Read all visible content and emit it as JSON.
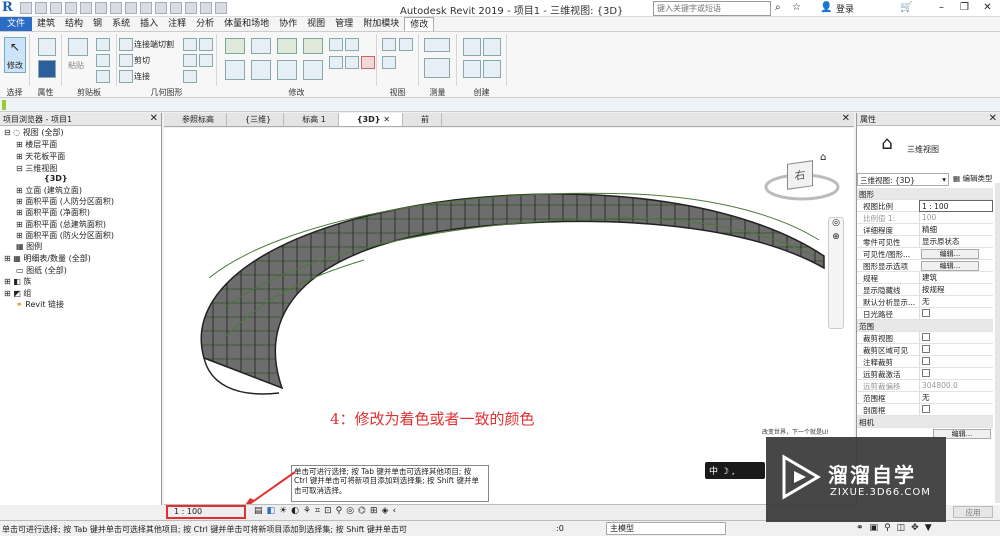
{
  "titlebar": {
    "title": "Autodesk Revit 2019 - 项目1 - 三维视图: {3D}",
    "search_placeholder": "键入关键字或短语",
    "login": "登录"
  },
  "menu": [
    "文件",
    "建筑",
    "结构",
    "钢",
    "系统",
    "插入",
    "注释",
    "分析",
    "体量和场地",
    "协作",
    "视图",
    "管理",
    "附加模块",
    "修改"
  ],
  "ribbon": {
    "modify": "修改",
    "groups": [
      "选择",
      "属性",
      "剪贴板",
      "几何图形",
      "修改",
      "视图",
      "测量",
      "创建"
    ],
    "paste": "粘贴",
    "join_cut": "连接端切割",
    "cut": "剪切",
    "join": "连接"
  },
  "browser": {
    "title": "项目浏览器 - 项目1",
    "items": [
      "视图 (全部)",
      "楼层平面",
      "天花板平面",
      "三维视图",
      "{3D}",
      "立面 (建筑立面)",
      "面积平面 (人防分区面积)",
      "面积平面 (净面积)",
      "面积平面 (总建筑面积)",
      "面积平面 (防火分区面积)",
      "图例",
      "明细表/数量 (全部)",
      "图纸 (全部)",
      "族",
      "组",
      "Revit 链接"
    ]
  },
  "tabs": [
    "参照标高",
    "{三维}",
    "标高 1",
    "{3D}",
    "前"
  ],
  "canvas": {
    "annotation": "4：修改为着色或者一致的颜色",
    "viewcube_face": "右",
    "promo": "改变世界，下一个就是U!",
    "tooltip": "单击可进行选择; 按 Tab 键并单击可选择其他项目; 按 Ctrl 键并单击可将新项目添加到选择集; 按 Shift 键并单击可取消选择。"
  },
  "viewbar": {
    "scale": "1 : 100"
  },
  "properties": {
    "title": "属性",
    "type_name": "三维视图",
    "selector": "三维视图: {3D}",
    "edit_type": "编辑类型",
    "sections": {
      "graphics": "图形",
      "extents": "范围",
      "camera": "相机"
    },
    "rows": [
      {
        "k": "视图比例",
        "v": "1 : 100"
      },
      {
        "k": "比例值 1:",
        "v": "100"
      },
      {
        "k": "详细程度",
        "v": "精细"
      },
      {
        "k": "零件可见性",
        "v": "显示原状态"
      },
      {
        "k": "可见性/图形...",
        "v": "编辑..."
      },
      {
        "k": "图形显示选项",
        "v": "编辑..."
      },
      {
        "k": "规程",
        "v": "建筑"
      },
      {
        "k": "显示隐藏线",
        "v": "按规程"
      },
      {
        "k": "默认分析显示...",
        "v": "无"
      },
      {
        "k": "日光路径",
        "v": ""
      }
    ],
    "rows2": [
      {
        "k": "裁剪视图"
      },
      {
        "k": "裁剪区域可见"
      },
      {
        "k": "注释裁剪"
      },
      {
        "k": "远剪裁激活"
      },
      {
        "k": "远剪裁偏移",
        "v": "304800.0"
      },
      {
        "k": "范围框",
        "v": "无"
      },
      {
        "k": "剖面框"
      }
    ],
    "apply": "应用",
    "edit2": "编辑..."
  },
  "status": {
    "text": "单击可进行选择; 按 Tab 键并单击可选择其他项目; 按 Ctrl 键并单击可将新项目添加到选择集; 按 Shift 键并单击可",
    "zero": ":0",
    "model": "主模型"
  },
  "ime": "中 ☽ ,",
  "watermark": {
    "brand": "溜溜自学",
    "url": "ZIXUE.3D66.COM"
  }
}
